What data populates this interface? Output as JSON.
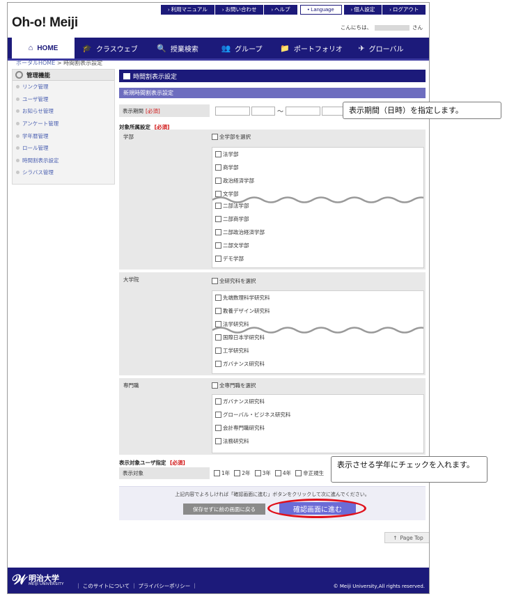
{
  "header": {
    "logo": "Oh-o! Meiji",
    "links": [
      "› 利用マニュアル",
      "› お問い合わせ",
      "› ヘルプ",
      "• Language",
      "› 個人設定",
      "› ログアウト"
    ],
    "greeting_prefix": "こんにちは、",
    "greeting_suffix": "さん"
  },
  "nav": [
    "HOME",
    "クラスウェブ",
    "授業検索",
    "グループ",
    "ポートフォリオ",
    "グローバル"
  ],
  "breadcrumb": {
    "home": "ポータルHOME",
    "sep": " > ",
    "current": "時間割表示設定"
  },
  "sidebar": {
    "title": "管理機能",
    "items": [
      "リンク管理",
      "ユーザ管理",
      "お知らせ管理",
      "アンケート管理",
      "学年暦管理",
      "ロール管理",
      "時間割表示設定",
      "シラバス管理"
    ]
  },
  "main": {
    "title": "時間割表示設定",
    "subtitle": "新規時間割表示設定",
    "period_label": "表示期間",
    "required": "[必須]",
    "tilde": "〜",
    "target_label": "対象所属設定",
    "faculty": {
      "name": "学部",
      "select_all": "全学部を選択",
      "items": [
        "法学部",
        "商学部",
        "政治経済学部",
        "文学部",
        "二部法学部",
        "二部商学部",
        "二部政治経済学部",
        "二部文学部",
        "デモ学部"
      ]
    },
    "graduate": {
      "name": "大学院",
      "select_all": "全研究科を選択",
      "items": [
        "先端数理科学研究科",
        "教養デザイン研究科",
        "法学研究科",
        "国際日本学研究科",
        "工学研究科",
        "ガバナンス研究科"
      ]
    },
    "professional": {
      "name": "専門職",
      "select_all": "全専門職を選択",
      "items": [
        "ガバナンス研究科",
        "グローバル・ビジネス研究科",
        "会計専門職研究科",
        "法務研究科"
      ]
    },
    "user_target_heading": "表示対象ユーザ指定",
    "user_target_label": "表示対象",
    "user_options": [
      "1年",
      "2年",
      "3年",
      "4年",
      "非正規生"
    ],
    "confirm_note": "上記内容でよろしければ「確認画面に進む」ボタンをクリックして次に進んでください。",
    "back_button": "保存せずに前の画面に戻る",
    "confirm_button": "確認画面に進む",
    "page_top": "Page Top"
  },
  "footer": {
    "logo_jp": "明治大学",
    "logo_en": "MEIJI UNIVERSITY",
    "links": "｜ このサイトについて ｜ プライバシーポリシー ｜",
    "copyright": "© Meiji University,All rights reserved."
  },
  "callouts": {
    "period": "表示期間（日時）を指定します。",
    "grade": "表示させる学年にチェックを入れます。"
  }
}
